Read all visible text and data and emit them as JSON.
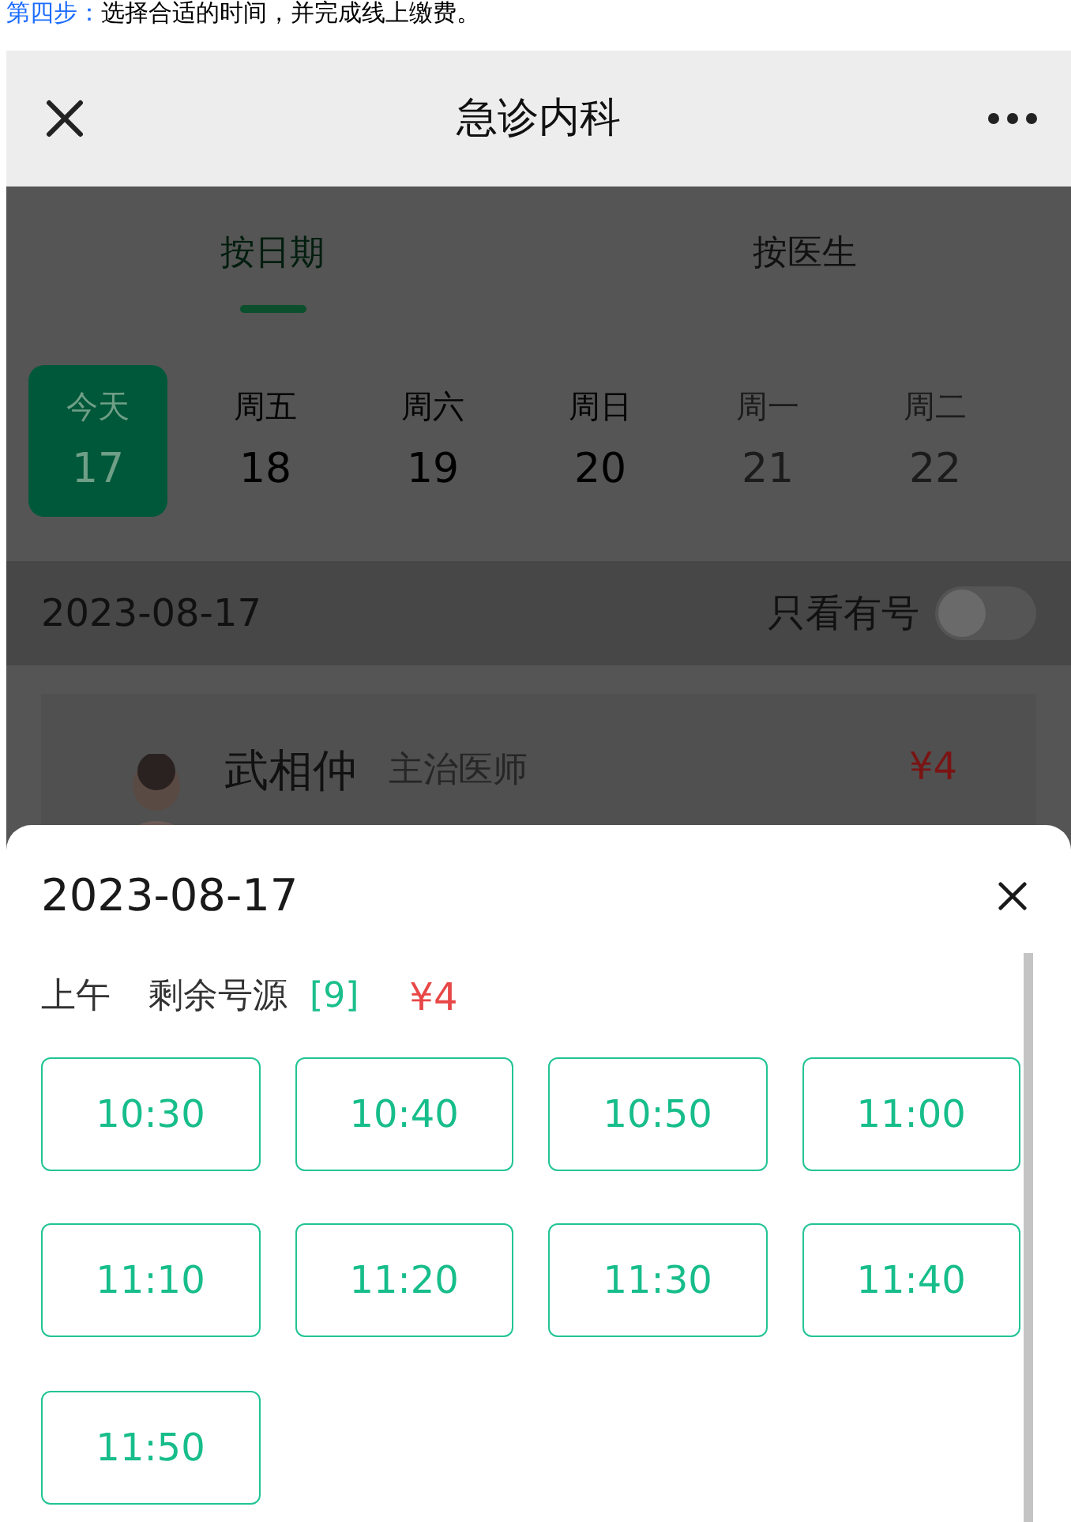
{
  "caption": {
    "step": "第四步：",
    "text": "选择合适的时间，并完成线上缴费。"
  },
  "header": {
    "title": "急诊内科"
  },
  "tabs": [
    {
      "label": "按日期",
      "selected": true
    },
    {
      "label": "按医生",
      "selected": false
    }
  ],
  "days": [
    {
      "weekday": "今天",
      "day": "17",
      "selected": true,
      "available": true
    },
    {
      "weekday": "周五",
      "day": "18",
      "selected": false,
      "available": true
    },
    {
      "weekday": "周六",
      "day": "19",
      "selected": false,
      "available": true
    },
    {
      "weekday": "周日",
      "day": "20",
      "selected": false,
      "available": true
    },
    {
      "weekday": "周一",
      "day": "21",
      "selected": false,
      "available": false
    },
    {
      "weekday": "周二",
      "day": "22",
      "selected": false,
      "available": false
    }
  ],
  "filter": {
    "date": "2023-08-17",
    "label": "只看有号",
    "on": false
  },
  "doctor": {
    "name": "武相仲",
    "title": "主治医师",
    "price": "¥4"
  },
  "sheet": {
    "date": "2023-08-17",
    "period": "上午",
    "remaining_label": "剩余号源",
    "remaining": "[9]",
    "price": "¥4",
    "slots": [
      "10:30",
      "10:40",
      "10:50",
      "11:00",
      "11:10",
      "11:20",
      "11:30",
      "11:40",
      "11:50"
    ]
  }
}
